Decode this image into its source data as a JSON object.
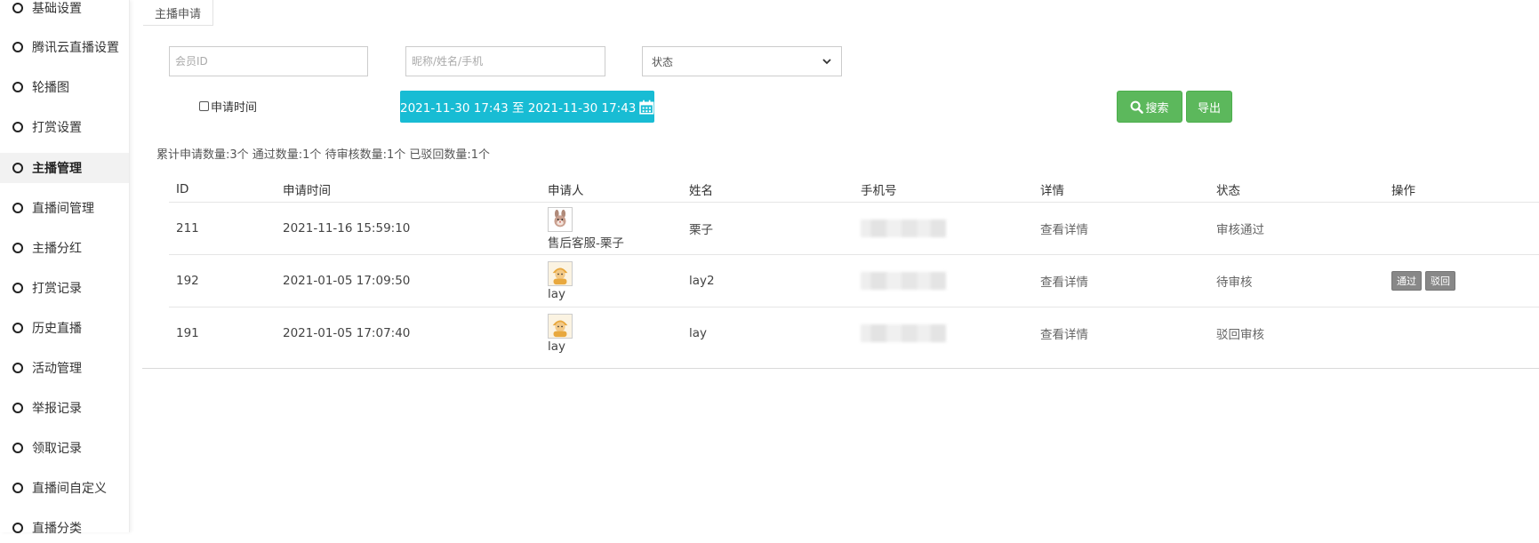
{
  "sidebar": {
    "items": [
      {
        "label": "基础设置",
        "active": false
      },
      {
        "label": "腾讯云直播设置",
        "active": false
      },
      {
        "label": "轮播图",
        "active": false
      },
      {
        "label": "打赏设置",
        "active": false
      },
      {
        "label": "主播管理",
        "active": true
      },
      {
        "label": "直播间管理",
        "active": false
      },
      {
        "label": "主播分红",
        "active": false
      },
      {
        "label": "打赏记录",
        "active": false
      },
      {
        "label": "历史直播",
        "active": false
      },
      {
        "label": "活动管理",
        "active": false
      },
      {
        "label": "举报记录",
        "active": false
      },
      {
        "label": "领取记录",
        "active": false
      },
      {
        "label": "直播间自定义",
        "active": false
      },
      {
        "label": "直播分类",
        "active": false
      }
    ],
    "icon": "circle-icon"
  },
  "tab": {
    "label": "主播申请"
  },
  "filters": {
    "member_id_placeholder": "会员ID",
    "keyword_placeholder": "昵称/姓名/手机",
    "status_selected": "状态",
    "apply_time_label": "申请时间",
    "date_range": "2021-11-30 17:43 至 2021-11-30 17:43",
    "search_label": "搜索",
    "export_label": "导出"
  },
  "summary": "累计申请数量:3个 通过数量:1个 待审核数量:1个 已驳回数量:1个",
  "table": {
    "headers": {
      "id": "ID",
      "time": "申请时间",
      "user": "申请人",
      "name": "姓名",
      "phone": "手机号",
      "detail": "详情",
      "status": "状态",
      "op": "操作"
    },
    "rows": [
      {
        "id": "211",
        "time": "2021-11-16 15:59:10",
        "user": "售后客服-栗子",
        "avatar": "bunny-avatar-icon",
        "name": "栗子",
        "detail": "查看详情",
        "status": "审核通过"
      },
      {
        "id": "192",
        "time": "2021-01-05 17:09:50",
        "user": "lay",
        "avatar": "cartoon-avatar-icon",
        "name": "lay2",
        "detail": "查看详情",
        "status": "待审核",
        "approve": "通过",
        "reject": "驳回"
      },
      {
        "id": "191",
        "time": "2021-01-05 17:07:40",
        "user": "lay",
        "avatar": "cartoon-avatar-icon",
        "name": "lay",
        "detail": "查看详情",
        "status": "驳回审核"
      }
    ]
  },
  "colors": {
    "accent_cyan": "#18bcd4",
    "green": "#5cb85c",
    "gray_button": "#888888"
  }
}
